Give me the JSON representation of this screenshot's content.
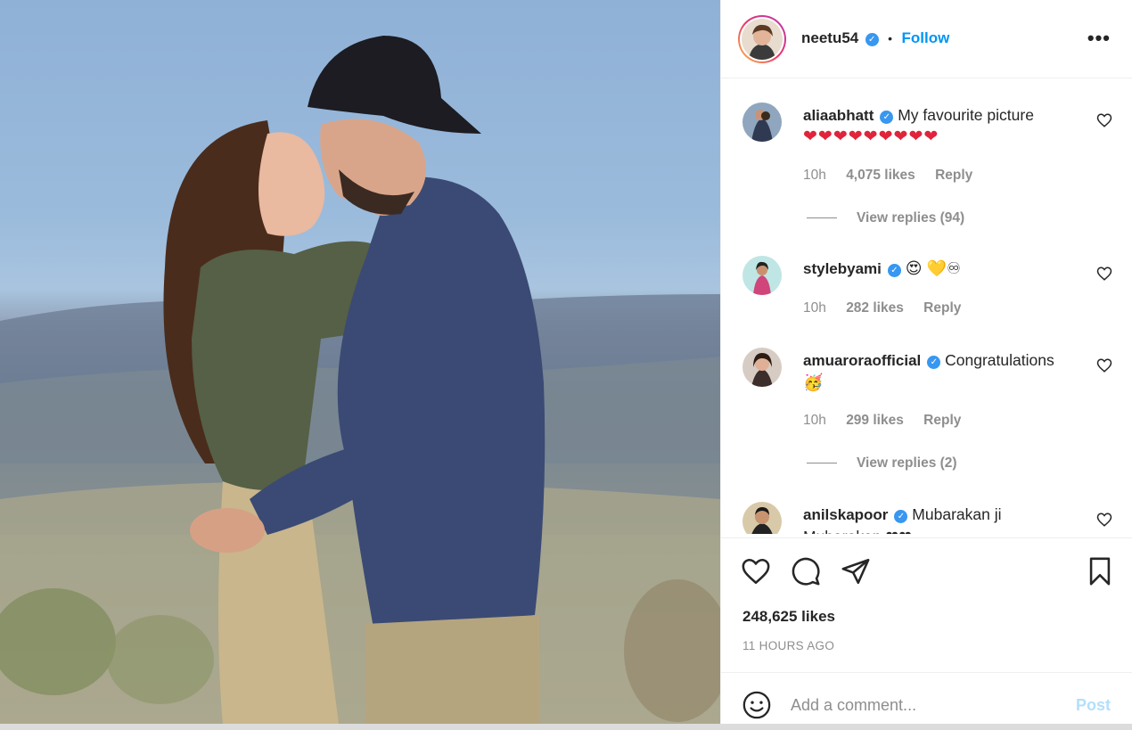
{
  "post": {
    "author": "neetu54",
    "follow_label": "Follow",
    "separator": "•",
    "more_label": "•••",
    "likes": "248,625 likes",
    "time_ago": "11 HOURS AGO"
  },
  "comments": [
    {
      "username": "aliaabhatt",
      "text": "My favourite picture",
      "emoji": "❤❤❤❤❤❤❤❤❤",
      "time": "10h",
      "likes": "4,075 likes",
      "reply": "Reply",
      "view_replies": "View replies (94)"
    },
    {
      "username": "stylebyami",
      "text": "",
      "emoji": "😍 💛♾",
      "time": "10h",
      "likes": "282 likes",
      "reply": "Reply"
    },
    {
      "username": "amuaroraofficial",
      "text": "Congratulations",
      "emoji": "🥳",
      "time": "10h",
      "likes": "299 likes",
      "reply": "Reply",
      "view_replies": "View replies (2)"
    },
    {
      "username": "anilskapoor",
      "text": "Mubarakan ji",
      "emoji": "Mubarakan ❤❤"
    }
  ],
  "composer": {
    "placeholder": "Add a comment...",
    "post_label": "Post"
  },
  "colors": {
    "accent": "#0095f6",
    "muted": "#8e8e8e",
    "post_disabled": "#b2dffc",
    "verified": "#3897f0"
  },
  "icons": [
    "heart-icon",
    "comment-icon",
    "share-icon",
    "bookmark-icon",
    "emoji-icon",
    "verified-badge-icon"
  ]
}
